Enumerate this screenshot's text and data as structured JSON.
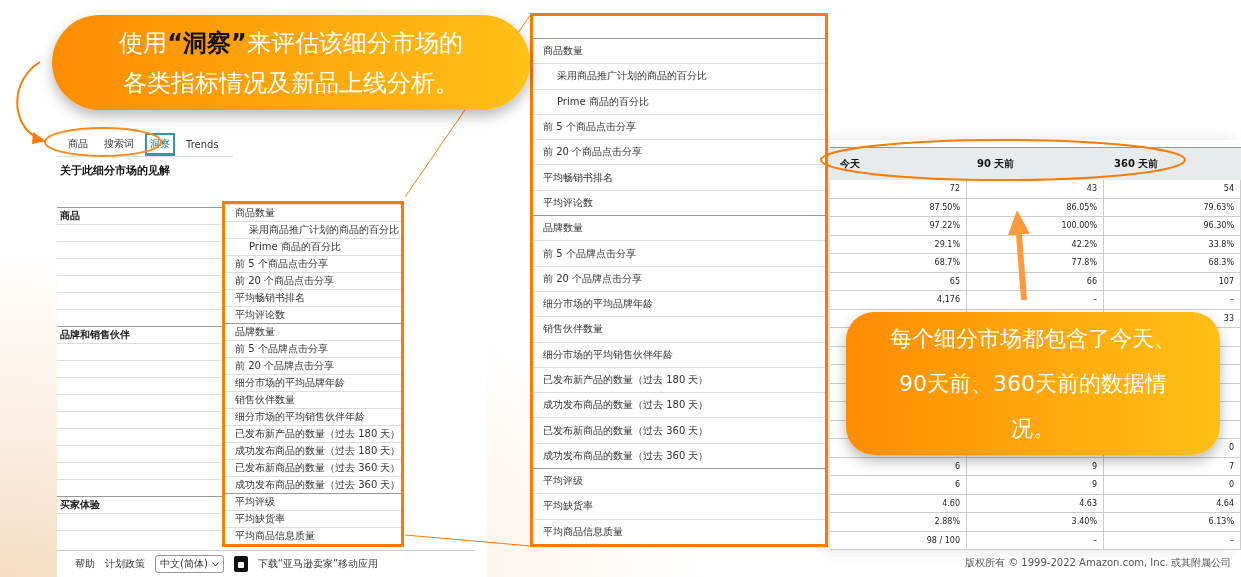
{
  "callouts": [
    {
      "lines": [
        "使用**“洞察”**来评估该细分市场的",
        "各类指标情况及新品上线分析。"
      ]
    },
    {
      "lines": [
        "每个细分市场都包含了今天、",
        "90天前、360天前的数据情",
        "况。"
      ]
    }
  ],
  "insights_page": {
    "tabs": [
      {
        "label": "商品",
        "selected": false
      },
      {
        "label": "搜索词",
        "selected": false
      },
      {
        "label": "洞察",
        "selected": true
      },
      {
        "label": "Trends",
        "selected": false
      }
    ],
    "title": "关于此细分市场的见解",
    "sections": [
      {
        "label": "商品",
        "metrics": [
          {
            "label": "商品数量",
            "kind": "main"
          },
          {
            "label": "采用商品推广计划的商品的百分比",
            "kind": "sub"
          },
          {
            "label": "Prime 商品的百分比",
            "kind": "sub"
          },
          {
            "label": "前 5 个商品点击分享",
            "kind": "main"
          },
          {
            "label": "前 20 个商品点击分享",
            "kind": "main"
          },
          {
            "label": "平均畅销书排名",
            "kind": "main"
          },
          {
            "label": "平均评论数",
            "kind": "main"
          }
        ]
      },
      {
        "label": "品牌和销售伙伴",
        "metrics": [
          {
            "label": "品牌数量",
            "kind": "main"
          },
          {
            "label": "前 5 个品牌点击分享",
            "kind": "main"
          },
          {
            "label": "前 20 个品牌点击分享",
            "kind": "main"
          },
          {
            "label": "细分市场的平均品牌年龄",
            "kind": "main"
          },
          {
            "label": "销售伙伴数量",
            "kind": "main"
          },
          {
            "label": "细分市场的平均销售伙伴年龄",
            "kind": "main"
          },
          {
            "label": "已发布新产品的数量（过去 180 天）",
            "kind": "main"
          },
          {
            "label": "成功发布商品的数量（过去 180 天）",
            "kind": "main"
          },
          {
            "label": "已发布新商品的数量（过去 360 天）",
            "kind": "main"
          },
          {
            "label": "成功发布商品的数量（过去 360 天）",
            "kind": "main"
          }
        ]
      },
      {
        "label": "买家体验",
        "metrics": [
          {
            "label": "平均评级",
            "kind": "main"
          },
          {
            "label": "平均缺货率",
            "kind": "main"
          },
          {
            "label": "平均商品信息质量",
            "kind": "main"
          }
        ]
      }
    ],
    "footer": {
      "links": [
        "帮助",
        "计划政策"
      ],
      "language": "中文(简体)",
      "app_link": "下载“亚马逊卖家”移动应用"
    }
  },
  "zoomed_groups": [
    {
      "metrics": [
        {
          "label": "商品数量",
          "kind": "main"
        },
        {
          "label": "采用商品推广计划的商品的百分比",
          "kind": "sub"
        },
        {
          "label": "Prime 商品的百分比",
          "kind": "sub"
        },
        {
          "label": "前 5 个商品点击分享",
          "kind": "main"
        },
        {
          "label": "前 20 个商品点击分享",
          "kind": "main"
        },
        {
          "label": "平均畅销书排名",
          "kind": "main"
        },
        {
          "label": "平均评论数",
          "kind": "main"
        }
      ]
    },
    {
      "metrics": [
        {
          "label": "品牌数量",
          "kind": "main"
        },
        {
          "label": "前 5 个品牌点击分享",
          "kind": "main"
        },
        {
          "label": "前 20 个品牌点击分享",
          "kind": "main"
        },
        {
          "label": "细分市场的平均品牌年龄",
          "kind": "main"
        },
        {
          "label": "销售伙伴数量",
          "kind": "main"
        },
        {
          "label": "细分市场的平均销售伙伴年龄",
          "kind": "main"
        },
        {
          "label": "已发布新产品的数量（过去 180 天）",
          "kind": "main"
        },
        {
          "label": "成功发布商品的数量（过去 180 天）",
          "kind": "main"
        },
        {
          "label": "已发布新商品的数量（过去 360 天）",
          "kind": "main"
        },
        {
          "label": "成功发布商品的数量（过去 360 天）",
          "kind": "main"
        }
      ]
    },
    {
      "metrics": [
        {
          "label": "平均评级",
          "kind": "main"
        },
        {
          "label": "平均缺货率",
          "kind": "main"
        },
        {
          "label": "平均商品信息质量",
          "kind": "main"
        }
      ]
    }
  ],
  "table": {
    "columns": [
      "今天",
      "90 天前",
      "360 天前"
    ],
    "rows": [
      {
        "cells": [
          "72",
          "43",
          "54"
        ]
      },
      {
        "cells": [
          "87.50%",
          "86.05%",
          "79.63%"
        ]
      },
      {
        "cells": [
          "97.22%",
          "100.00%",
          "96.30%"
        ]
      },
      {
        "cells": [
          "29.1%",
          "42.2%",
          "33.8%"
        ]
      },
      {
        "cells": [
          "68.7%",
          "77.8%",
          "68.3%"
        ]
      },
      {
        "cells": [
          "65",
          "66",
          "107"
        ]
      },
      {
        "cells": [
          "4,176",
          "–",
          "–"
        ]
      },
      {
        "cells": [
          null,
          null,
          "33"
        ]
      },
      {
        "cells": [
          null,
          null,
          null
        ]
      },
      {
        "cells": [
          null,
          null,
          null
        ]
      },
      {
        "cells": [
          null,
          null,
          null
        ]
      },
      {
        "cells": [
          null,
          null,
          null
        ]
      },
      {
        "cells": [
          null,
          null,
          null
        ]
      },
      {
        "cells": [
          null,
          null,
          null
        ]
      },
      {
        "cells": [
          null,
          null,
          "0"
        ]
      },
      {
        "cells": [
          "6",
          "9",
          "7"
        ]
      },
      {
        "cells": [
          "6",
          "9",
          "0"
        ]
      },
      {
        "cells": [
          "4.60",
          "4.63",
          "4.64"
        ]
      },
      {
        "cells": [
          "2.88%",
          "3.40%",
          "6.13%"
        ]
      },
      {
        "cells": [
          "98 / 100",
          "–",
          "–"
        ]
      }
    ]
  },
  "copyright": "版权所有 © 1999-2022 Amazon.com, Inc. 或其附属公司"
}
